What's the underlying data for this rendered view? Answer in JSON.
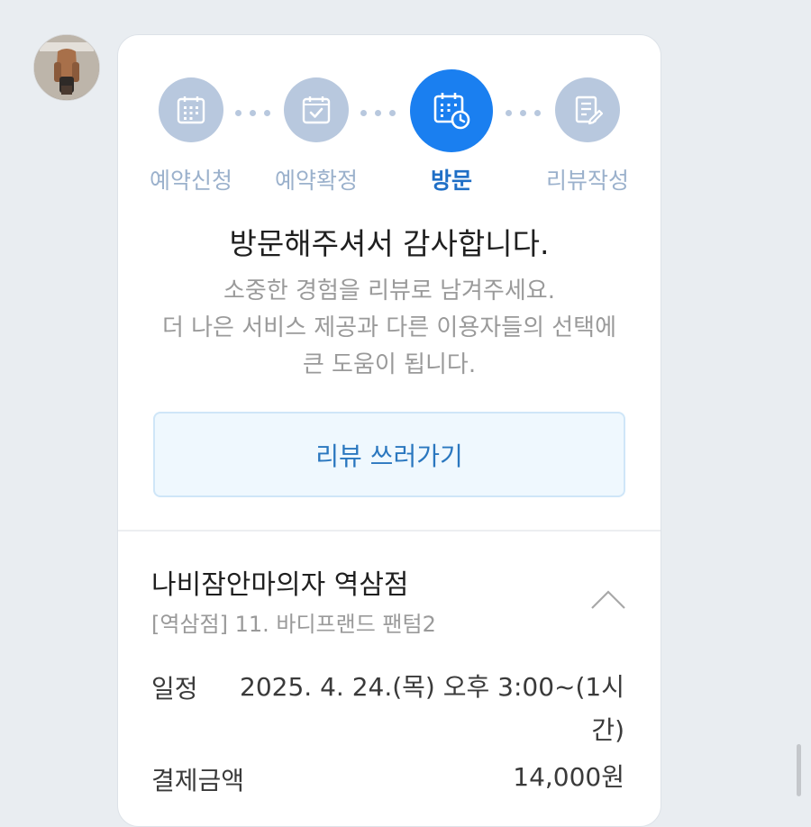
{
  "steps": [
    {
      "label": "예약신청",
      "icon": "calendar-icon",
      "active": false
    },
    {
      "label": "예약확정",
      "icon": "calendar-check-icon",
      "active": false
    },
    {
      "label": "방문",
      "icon": "calendar-clock-icon",
      "active": true
    },
    {
      "label": "리뷰작성",
      "icon": "edit-document-icon",
      "active": false
    }
  ],
  "message": {
    "title": "방문해주셔서 감사합니다.",
    "line1": "소중한 경험을 리뷰로 남겨주세요.",
    "line2": "더 나은 서비스 제공과 다른 이용자들의 선택에",
    "line3": "큰 도움이 됩니다."
  },
  "review_button": "리뷰 쓰러가기",
  "booking": {
    "store_name": "나비잠안마의자 역삼점",
    "item": "[역삼점] 11. 바디프랜드 팬텀2",
    "schedule_label": "일정",
    "schedule_line1": "2025. 4. 24.(목) 오후 3:00~(1시",
    "schedule_line2": "간)",
    "payment_label": "결제금액",
    "payment_value": "14,000원"
  },
  "colors": {
    "active": "#1a7ff0",
    "inactive": "#b8c8de",
    "active_label": "#1f6fc6",
    "inactive_label": "#9bb1cc"
  }
}
